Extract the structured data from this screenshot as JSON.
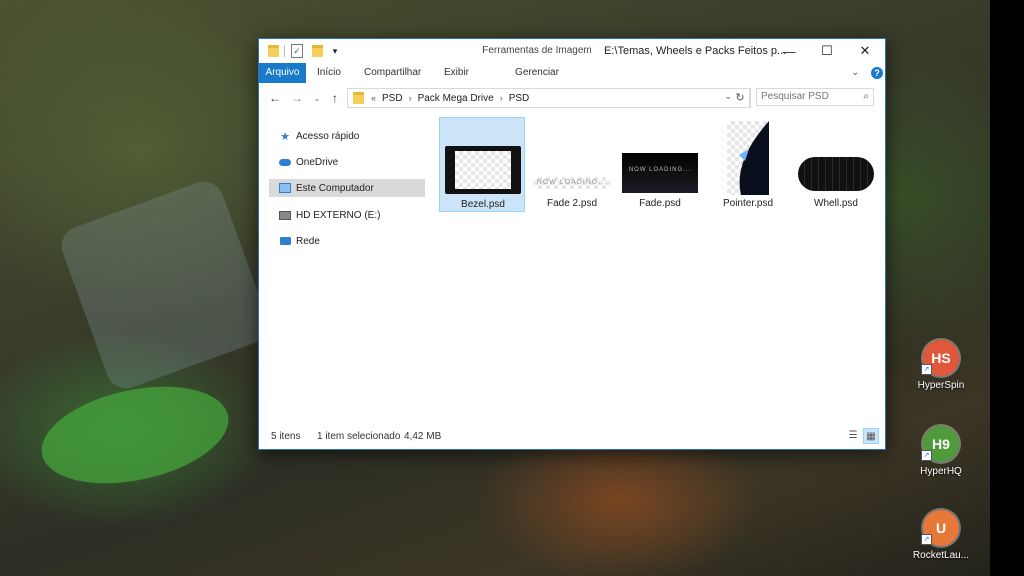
{
  "titlebar": {
    "context_tab_label": "Ferramentas de Imagem",
    "title": "E:\\Temas, Wheels e Packs Feitos p...",
    "minimize": "—",
    "maximize": "☐",
    "close": "✕"
  },
  "ribbon": {
    "tabs": [
      "Arquivo",
      "Início",
      "Compartilhar",
      "Exibir"
    ],
    "context_sub_tab": "Gerenciar",
    "expand_glyph": "⌄",
    "help_glyph": "?"
  },
  "navigation": {
    "back": "←",
    "forward": "→",
    "recent": "⌄",
    "up": "↑",
    "overflow": "«",
    "breadcrumbs": [
      "PSD",
      "Pack Mega Drive",
      "PSD"
    ],
    "refresh": "↻",
    "search_placeholder": "Pesquisar PSD"
  },
  "nav_pane": {
    "items": [
      {
        "label": "Acesso rápido",
        "icon": "star-icon"
      },
      {
        "label": "OneDrive",
        "icon": "cloud-icon"
      },
      {
        "label": "Este Computador",
        "icon": "computer-icon",
        "selected": true
      },
      {
        "label": "HD EXTERNO (E:)",
        "icon": "drive-icon"
      },
      {
        "label": "Rede",
        "icon": "network-icon"
      }
    ]
  },
  "files": [
    {
      "name": "Bezel.psd",
      "selected": true
    },
    {
      "name": "Fade 2.psd",
      "thumb_text": "NOW LOADING..."
    },
    {
      "name": "Fade.psd",
      "thumb_text": "NOW LOADING..."
    },
    {
      "name": "Pointer.psd"
    },
    {
      "name": "Whell.psd"
    }
  ],
  "status": {
    "count": "5 itens",
    "selection": "1 item selecionado",
    "size": "4,42 MB"
  },
  "desktop_icons": [
    {
      "label": "HyperSpin",
      "badge": "HS",
      "color": "#e0573a"
    },
    {
      "label": "HyperHQ",
      "badge": "H9",
      "color": "#4f9a3a"
    },
    {
      "label": "RocketLau...",
      "badge": "U",
      "color": "#e8783a"
    }
  ]
}
